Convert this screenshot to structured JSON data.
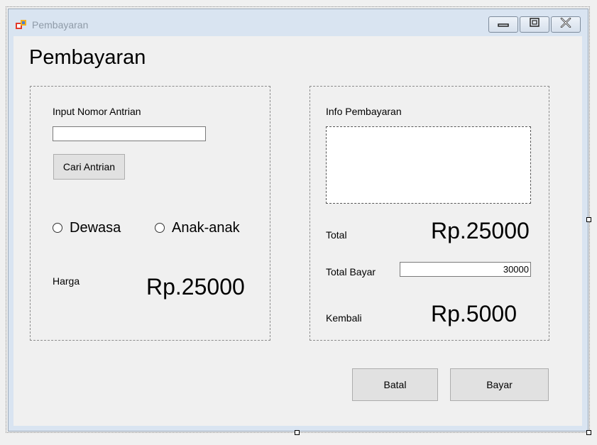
{
  "window": {
    "title": "Pembayaran"
  },
  "heading": "Pembayaran",
  "left_panel": {
    "label": "Input Nomor Antrian",
    "input_value": "",
    "search_button": "Cari Antrian",
    "radio_dewasa": "Dewasa",
    "radio_anak": "Anak-anak",
    "price_label": "Harga",
    "price_value": "Rp.25000"
  },
  "right_panel": {
    "label": "Info Pembayaran",
    "info_text": "",
    "total_label": "Total",
    "total_value": "Rp.25000",
    "paid_label": "Total Bayar",
    "paid_value": "30000",
    "change_label": "Kembali",
    "change_value": "Rp.5000"
  },
  "actions": {
    "cancel": "Batal",
    "pay": "Bayar"
  },
  "colors": {
    "window_frame": "#d9e4f1",
    "client_bg": "#f0f0f0",
    "button_bg": "#e1e1e1"
  }
}
